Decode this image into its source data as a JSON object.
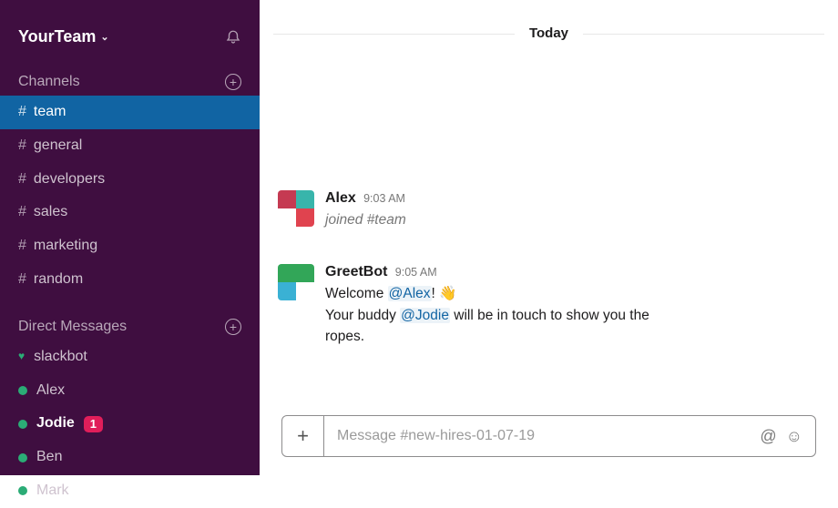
{
  "team_name": "YourTeam",
  "sidebar": {
    "channels_label": "Channels",
    "channels": [
      {
        "name": "team",
        "selected": true
      },
      {
        "name": "general",
        "selected": false
      },
      {
        "name": "developers",
        "selected": false
      },
      {
        "name": "sales",
        "selected": false
      },
      {
        "name": "marketing",
        "selected": false
      },
      {
        "name": "random",
        "selected": false
      }
    ],
    "dms_label": "Direct Messages",
    "dms": [
      {
        "name": "slackbot",
        "presence": "heart",
        "unread": 0,
        "bold": false
      },
      {
        "name": "Alex",
        "presence": "green",
        "unread": 0,
        "bold": false
      },
      {
        "name": "Jodie",
        "presence": "green",
        "unread": 1,
        "bold": true
      },
      {
        "name": "Ben",
        "presence": "green",
        "unread": 0,
        "bold": false
      },
      {
        "name": "Mark",
        "presence": "green",
        "unread": 0,
        "bold": false
      }
    ]
  },
  "day_label": "Today",
  "messages": {
    "alex": {
      "sender": "Alex",
      "time": "9:03 AM",
      "joined_prefix": "joined ",
      "joined_channel": "#team"
    },
    "greetbot": {
      "sender": "GreetBot",
      "time": "9:05 AM",
      "line1_pre": "Welcome ",
      "line1_mention": "@Alex",
      "line1_post": "! ",
      "wave": "👋",
      "line2_pre": "Your buddy ",
      "line2_mention": "@Jodie",
      "line2_post": " will be in touch to show you the ropes."
    }
  },
  "composer": {
    "placeholder": "Message #new-hires-01-07-19"
  }
}
